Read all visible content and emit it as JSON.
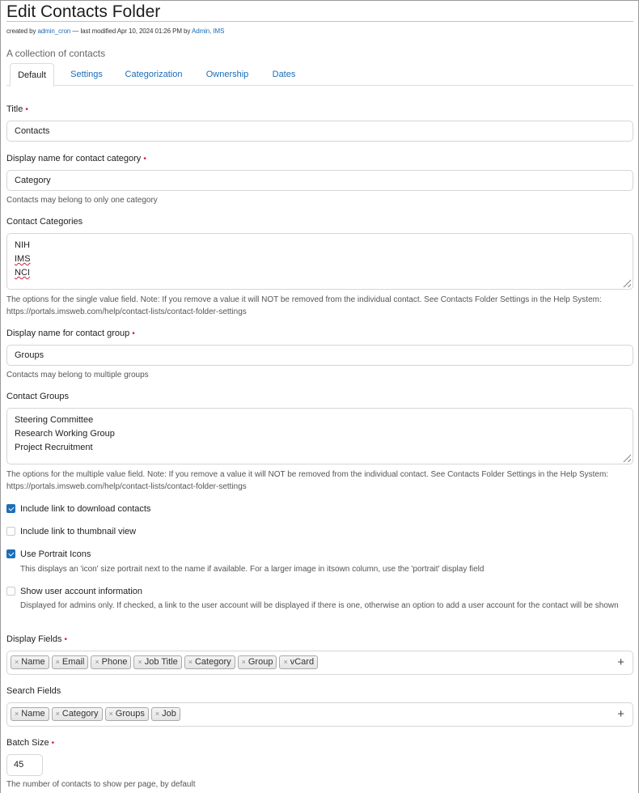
{
  "page": {
    "title": "Edit Contacts Folder",
    "byline": {
      "created_prefix": "created by",
      "creator": "admin_cron",
      "modified_text": "— last modified Apr 10, 2024 01:26 PM by",
      "modifier": "Admin, IMS"
    },
    "description": "A collection of contacts"
  },
  "tabs": [
    {
      "label": "Default",
      "active": true
    },
    {
      "label": "Settings",
      "active": false
    },
    {
      "label": "Categorization",
      "active": false
    },
    {
      "label": "Ownership",
      "active": false
    },
    {
      "label": "Dates",
      "active": false
    }
  ],
  "form": {
    "title": {
      "label": "Title",
      "required": "•",
      "value": "Contacts"
    },
    "category_name": {
      "label": "Display name for contact category",
      "required": "•",
      "value": "Category",
      "help": "Contacts may belong to only one category"
    },
    "categories": {
      "label": "Contact Categories",
      "lines": [
        "NIH",
        "IMS",
        "NCI"
      ],
      "help": "The options for the single value field. Note: If you remove a value it will NOT be removed from the individual contact. See Contacts Folder Settings in the Help System: https://portals.imsweb.com/help/contact-lists/contact-folder-settings"
    },
    "group_name": {
      "label": "Display name for contact group",
      "required": "•",
      "value": "Groups",
      "help": "Contacts may belong to multiple groups"
    },
    "groups": {
      "label": "Contact Groups",
      "lines": [
        "Steering Committee",
        "Research Working Group",
        "Project Recruitment"
      ],
      "help": "The options for the multiple value field. Note: If you remove a value it will NOT be removed from the individual contact. See Contacts Folder Settings in the Help System: https://portals.imsweb.com/help/contact-lists/contact-folder-settings"
    },
    "checkboxes": [
      {
        "label": "Include link to download contacts",
        "checked": true,
        "help": ""
      },
      {
        "label": "Include link to thumbnail view",
        "checked": false,
        "help": ""
      },
      {
        "label": "Use Portrait Icons",
        "checked": true,
        "help": "This displays an 'icon' size portrait next to the name if available. For a larger image in itsown column, use the 'portrait' display field"
      },
      {
        "label": "Show user account information",
        "checked": false,
        "help": "Displayed for admins only. If checked, a link to the user account will be displayed if there is one, otherwise an option to add a user account for the contact will be shown"
      }
    ],
    "display_fields": {
      "label": "Display Fields",
      "required": "•",
      "tags": [
        "Name",
        "Email",
        "Phone",
        "Job Title",
        "Category",
        "Group",
        "vCard"
      ],
      "add_icon": "+"
    },
    "search_fields": {
      "label": "Search Fields",
      "tags": [
        "Name",
        "Category",
        "Groups",
        "Job"
      ],
      "add_icon": "+"
    },
    "batch_size": {
      "label": "Batch Size",
      "required": "•",
      "value": "45",
      "help": "The number of contacts to show per page, by default"
    },
    "remove_icon": "×"
  }
}
